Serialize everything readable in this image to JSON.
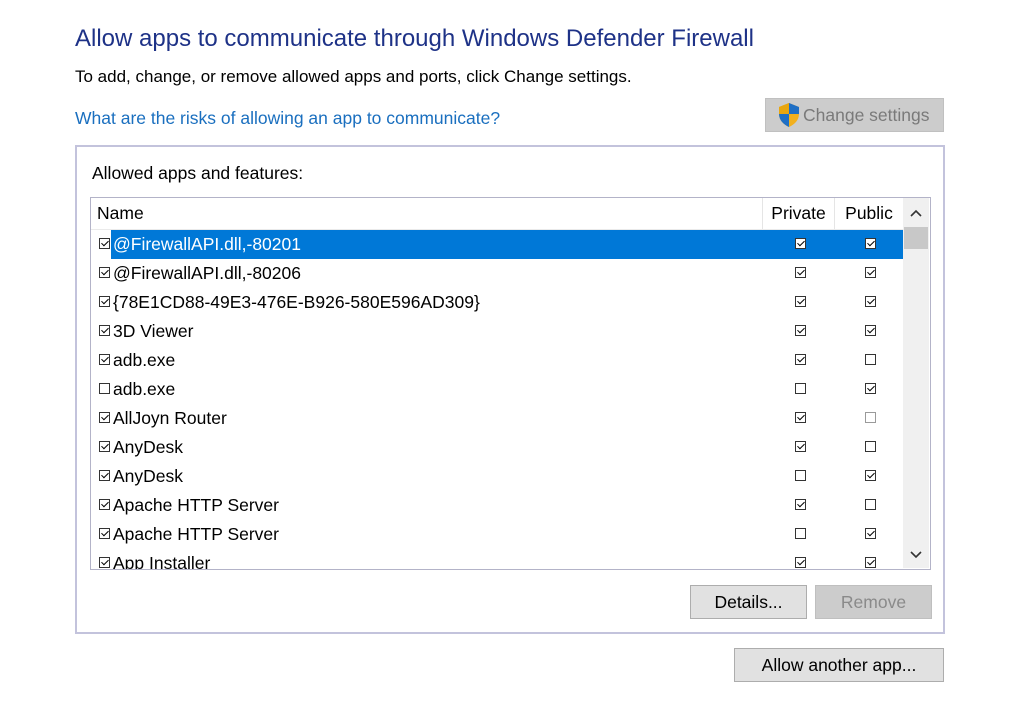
{
  "header": {
    "title": "Allow apps to communicate through Windows Defender Firewall",
    "subtitle": "To add, change, or remove allowed apps and ports, click Change settings.",
    "risk_link": "What are the risks of allowing an app to communicate?",
    "change_settings_label": "Change settings"
  },
  "group": {
    "label": "Allowed apps and features:"
  },
  "table": {
    "columns": {
      "name": "Name",
      "private": "Private",
      "public": "Public"
    },
    "rows": [
      {
        "enabled": true,
        "name": "@FirewallAPI.dll,-80201",
        "private": true,
        "public": true,
        "selected": true
      },
      {
        "enabled": true,
        "name": "@FirewallAPI.dll,-80206",
        "private": true,
        "public": true
      },
      {
        "enabled": true,
        "name": "{78E1CD88-49E3-476E-B926-580E596AD309}",
        "private": true,
        "public": true
      },
      {
        "enabled": true,
        "name": "3D Viewer",
        "private": true,
        "public": true
      },
      {
        "enabled": true,
        "name": "adb.exe",
        "private": true,
        "public": false
      },
      {
        "enabled": false,
        "name": "adb.exe",
        "private": false,
        "public": true
      },
      {
        "enabled": true,
        "name": "AllJoyn Router",
        "private": true,
        "public": false,
        "public_dim": true
      },
      {
        "enabled": true,
        "name": "AnyDesk",
        "private": true,
        "public": false
      },
      {
        "enabled": true,
        "name": "AnyDesk",
        "private": false,
        "public": true
      },
      {
        "enabled": true,
        "name": "Apache HTTP Server",
        "private": true,
        "public": false
      },
      {
        "enabled": true,
        "name": "Apache HTTP Server",
        "private": false,
        "public": true
      },
      {
        "enabled": true,
        "name": "App Installer",
        "private": true,
        "public": true
      }
    ]
  },
  "buttons": {
    "details": "Details...",
    "remove": "Remove",
    "allow_another": "Allow another app..."
  },
  "icons": {
    "shield": "uac-shield-icon",
    "scroll_up": "chevron-up-icon",
    "scroll_down": "chevron-down-icon"
  }
}
